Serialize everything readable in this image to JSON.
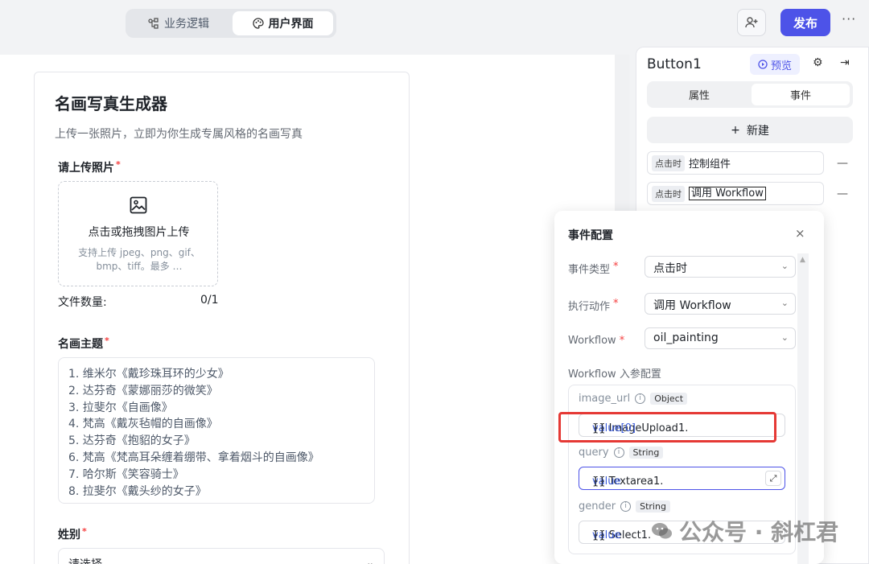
{
  "topbar": {
    "tabs": [
      {
        "label": "业务逻辑",
        "icon": "logic-icon"
      },
      {
        "label": "用户界面",
        "icon": "palette-icon"
      }
    ],
    "publish_label": "发布",
    "more_label": "···"
  },
  "form": {
    "title": "名画写真生成器",
    "subtitle": "上传一张照片，立即为你生成专属风格的名画写真",
    "upload_label": "请上传照片",
    "upload_main": "点击或拖拽图片上传",
    "upload_hint": "支持上传 jpeg、png、gif、bmp、tiff。最多 …",
    "file_count_label": "文件数量:",
    "file_count_value": "0/1",
    "theme_label": "名画主题",
    "theme_lines": [
      "1. 维米尔《戴珍珠耳环的少女》",
      "2. 达芬奇《蒙娜丽莎的微笑》",
      "3. 拉斐尔《自画像》",
      "4. 梵高《戴灰毡帽的自画像》",
      "5. 达芬奇《抱貂的女子》",
      "6. 梵高《梵高耳朵缠着绷带、拿着烟斗的自画像》",
      "7. 哈尔斯《笑容骑士》",
      "8. 拉斐尔《戴头纱的女子》"
    ],
    "gender_label": "姓别",
    "gender_placeholder": "请选择",
    "required_mark": "*"
  },
  "panel": {
    "component_name": "Button1",
    "preview_label": "预览",
    "tabs": [
      "属性",
      "事件"
    ],
    "new_label": "新建",
    "events": [
      {
        "tag": "点击时",
        "action": "控制组件"
      },
      {
        "tag": "点击时",
        "action": "调用 Workflow"
      }
    ],
    "remove_label": "—"
  },
  "popover": {
    "title": "事件配置",
    "close_label": "×",
    "event_type_label": "事件类型",
    "event_type_value": "点击时",
    "action_label": "执行动作",
    "action_value": "调用 Workflow",
    "workflow_label": "Workflow",
    "workflow_value": "oil_painting",
    "params_title": "Workflow 入参配置",
    "params": [
      {
        "name": "image_url",
        "type": "Object",
        "pre": "{{ ImageUpload1.",
        "key": "value[0]",
        "post": " }}"
      },
      {
        "name": "query",
        "type": "String",
        "pre": "{{ Textarea1.",
        "key": "value",
        "post": " }}"
      },
      {
        "name": "gender",
        "type": "String",
        "pre": "{{ Select1.",
        "key": "value",
        "post": " }}"
      }
    ]
  },
  "watermark": "公众号 · 斜杠君",
  "colors": {
    "accent": "#4d53e8",
    "highlight_box": "#e53935",
    "required": "#f53f3f"
  }
}
